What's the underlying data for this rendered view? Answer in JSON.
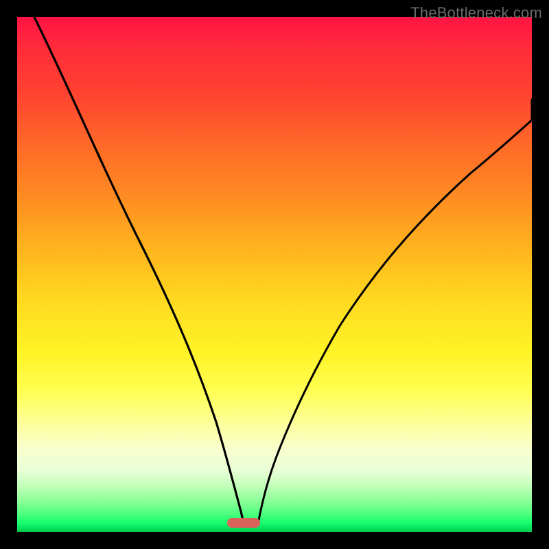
{
  "watermark": "TheBottleneck.com",
  "chart_data": {
    "type": "line",
    "title": "",
    "xlabel": "",
    "ylabel": "",
    "xlim": [
      0,
      100
    ],
    "ylim": [
      0,
      100
    ],
    "grid": false,
    "note": "Stylized bottleneck curve over vertical performance gradient (red=bad at top, green=good at bottom). Two black curves descend from upper-left and upper-right, meeting near the bottom at the optimal point (marker). Values are approximate positions read from the image in percent of plot area.",
    "background_gradient_stops": [
      {
        "pos": 0,
        "color": "#ff1444"
      },
      {
        "pos": 15,
        "color": "#ff4330"
      },
      {
        "pos": 35,
        "color": "#ff8c22"
      },
      {
        "pos": 55,
        "color": "#ffd920"
      },
      {
        "pos": 73,
        "color": "#ffff55"
      },
      {
        "pos": 88,
        "color": "#eaffd7"
      },
      {
        "pos": 96.5,
        "color": "#4eff7e"
      },
      {
        "pos": 100,
        "color": "#04c74f"
      }
    ],
    "series": [
      {
        "name": "left-curve",
        "x": [
          3.3,
          8.0,
          13.3,
          18.7,
          24.0,
          28.0,
          32.0,
          35.3,
          38.0,
          40.0,
          41.3,
          42.3,
          43.0,
          43.5,
          43.9
        ],
        "y_from_top": [
          0.0,
          10.7,
          22.7,
          34.7,
          46.7,
          56.0,
          64.7,
          72.0,
          78.7,
          84.0,
          88.0,
          91.3,
          94.0,
          96.0,
          97.7
        ]
      },
      {
        "name": "right-curve",
        "x": [
          46.9,
          47.3,
          48.0,
          49.3,
          51.3,
          54.0,
          57.3,
          61.3,
          66.0,
          71.3,
          77.3,
          84.7,
          92.7,
          100.0
        ],
        "y_from_top": [
          97.7,
          96.0,
          93.3,
          89.3,
          84.0,
          77.3,
          70.0,
          62.0,
          53.3,
          45.3,
          37.3,
          29.3,
          22.0,
          16.0
        ]
      }
    ],
    "marker": {
      "x": 44.0,
      "width_pct": 6.4,
      "color": "#d9635b"
    }
  }
}
